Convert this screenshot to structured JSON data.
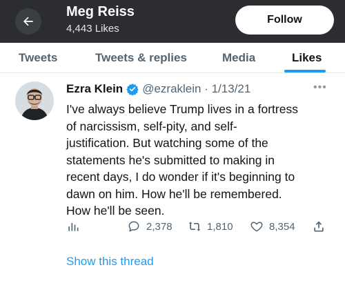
{
  "header": {
    "name": "Meg Reiss",
    "likes_count": "4,443 Likes",
    "follow_label": "Follow"
  },
  "tabs": [
    {
      "label": "Tweets"
    },
    {
      "label": "Tweets & replies"
    },
    {
      "label": "Media"
    },
    {
      "label": "Likes"
    }
  ],
  "active_tab": "Likes",
  "tweet": {
    "author_name": "Ezra Klein",
    "handle_date": "@ezraklein · 1/13/21",
    "more_icon": "more-icon",
    "lines": [
      "I've always believe Trump lives in a fortress",
      "of narcissism, self-pity, and self-",
      "justification. But watching some of the",
      "statements he's submitted to making in",
      "recent days, I do wonder if it's beginning to",
      "dawn on him. How he'll be remembered.",
      "How he'll be seen."
    ],
    "replies": "2,378",
    "retweets": "1,810",
    "likes": "8,354",
    "show_thread": "Show this thread"
  },
  "colors": {
    "header_bg": "#2b2d31",
    "accent": "#1d9bf0",
    "muted": "#536471",
    "verified": "#1d9bf0"
  }
}
